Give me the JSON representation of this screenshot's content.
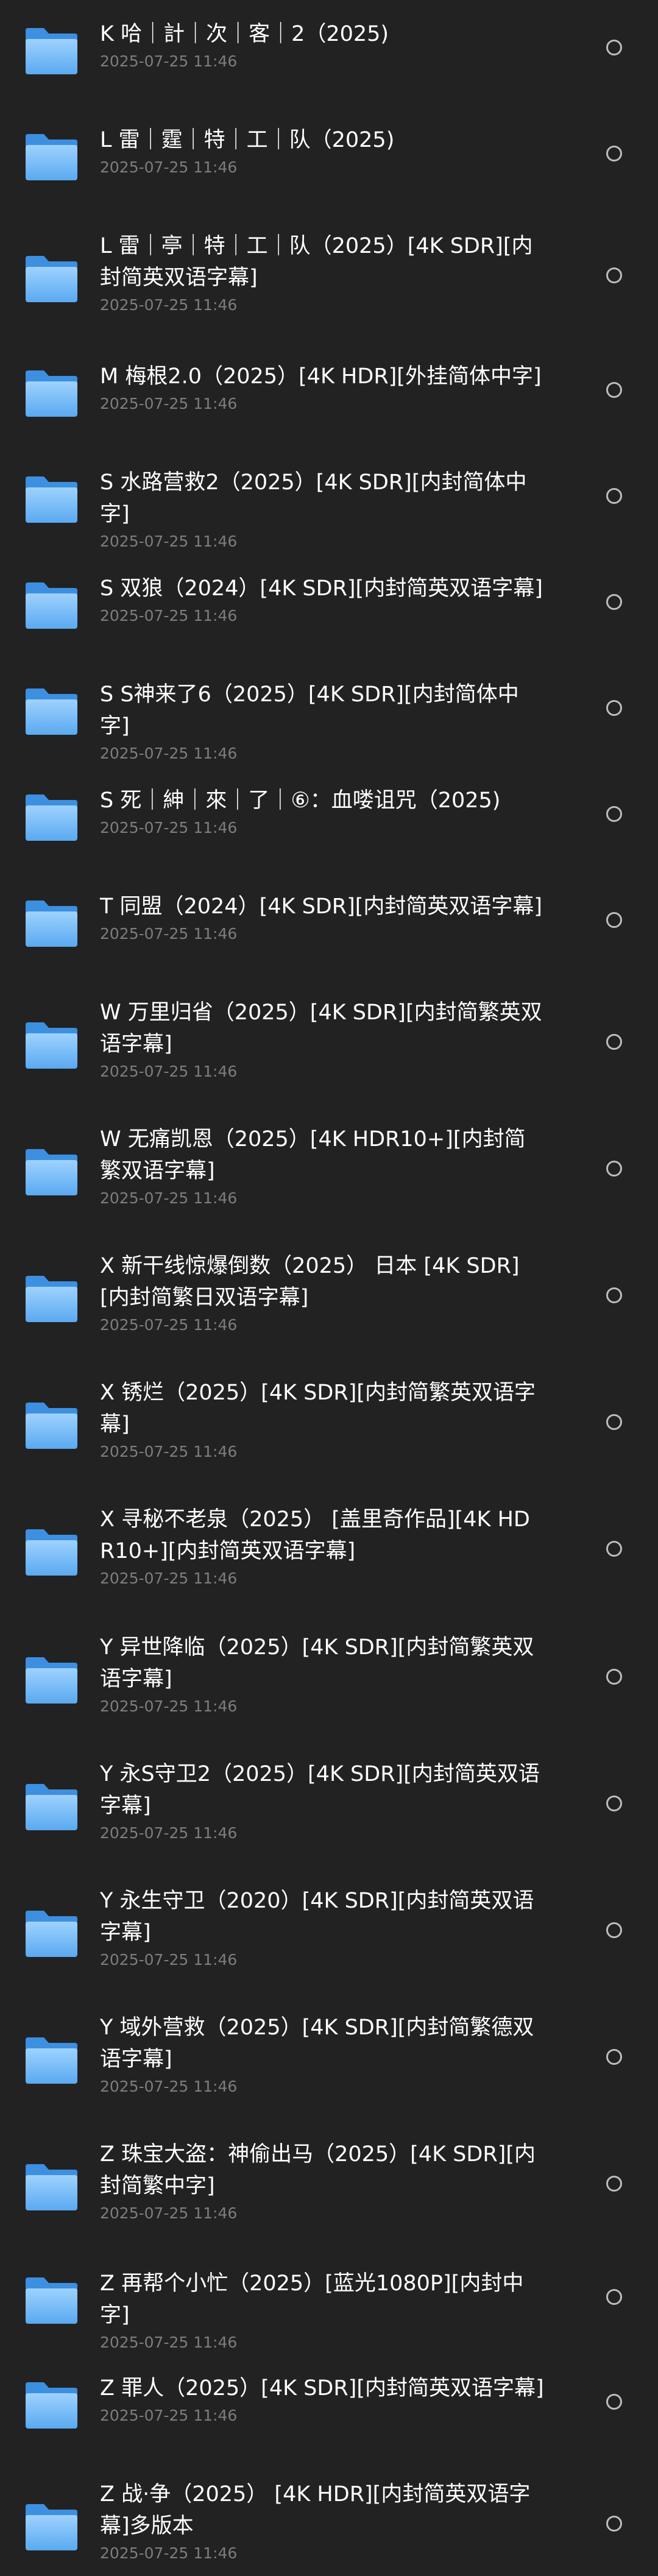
{
  "items": [
    {
      "name": "K 哈｜計｜次｜客｜2（2025)",
      "date": "2025-07-25 11:46"
    },
    {
      "name": "L 雷｜霆｜特｜工｜队（2025)",
      "date": "2025-07-25 11:46"
    },
    {
      "name": "L 雷｜亭｜特｜工｜队（2025）[4K SDR][内封简英双语字幕]",
      "date": "2025-07-25 11:46"
    },
    {
      "name": "M 梅根2.0（2025）[4K HDR][外挂简体中字]",
      "date": "2025-07-25 11:46"
    },
    {
      "name": "S 水路营救2（2025）[4K SDR][内封简体中字]",
      "date": "2025-07-25 11:46"
    },
    {
      "name": "S 双狼（2024）[4K SDR][内封简英双语字幕]",
      "date": "2025-07-25 11:46"
    },
    {
      "name": "S S神来了6（2025）[4K SDR][内封简体中字]",
      "date": "2025-07-25 11:46"
    },
    {
      "name": "S 死｜紳｜來｜了｜⑥：血喽诅咒（2025)",
      "date": "2025-07-25 11:46"
    },
    {
      "name": "T 同盟（2024）[4K SDR][内封简英双语字幕]",
      "date": "2025-07-25 11:46"
    },
    {
      "name": "W 万里归省（2025）[4K SDR][内封简繁英双语字幕]",
      "date": "2025-07-25 11:46"
    },
    {
      "name": "W 无痛凯恩（2025）[4K HDR10+][内封简繁双语字幕]",
      "date": "2025-07-25 11:46"
    },
    {
      "name": "X 新干线惊爆倒数（2025） 日本 [4K SDR][内封简繁日双语字幕]",
      "date": "2025-07-25 11:46"
    },
    {
      "name": "X 锈烂（2025）[4K SDR][内封简繁英双语字幕]",
      "date": "2025-07-25 11:46"
    },
    {
      "name": "X 寻秘不老泉（2025） [盖里奇作品][4K HDR10+][内封简英双语字幕]",
      "date": "2025-07-25 11:46"
    },
    {
      "name": "Y 异世降临（2025）[4K SDR][内封简繁英双语字幕]",
      "date": "2025-07-25 11:46"
    },
    {
      "name": "Y 永S守卫2（2025）[4K SDR][内封简英双语字幕]",
      "date": "2025-07-25 11:46"
    },
    {
      "name": "Y 永生守卫（2020）[4K SDR][内封简英双语字幕]",
      "date": "2025-07-25 11:46"
    },
    {
      "name": "Y 域外营救（2025）[4K SDR][内封简繁德双语字幕]",
      "date": "2025-07-25 11:46"
    },
    {
      "name": "Z 珠宝大盗：神偷出马（2025）[4K SDR][内封简繁中字]",
      "date": "2025-07-25 11:46"
    },
    {
      "name": "Z 再帮个小忙（2025）[蓝光1080P][内封中字]",
      "date": "2025-07-25 11:46"
    },
    {
      "name": "Z 罪人（2025）[4K SDR][内封简英双语字幕]",
      "date": "2025-07-25 11:46"
    },
    {
      "name": "Z 战·争（2025） [4K HDR][内封简英双语字幕]多版本",
      "date": "2025-07-25 11:46"
    }
  ]
}
